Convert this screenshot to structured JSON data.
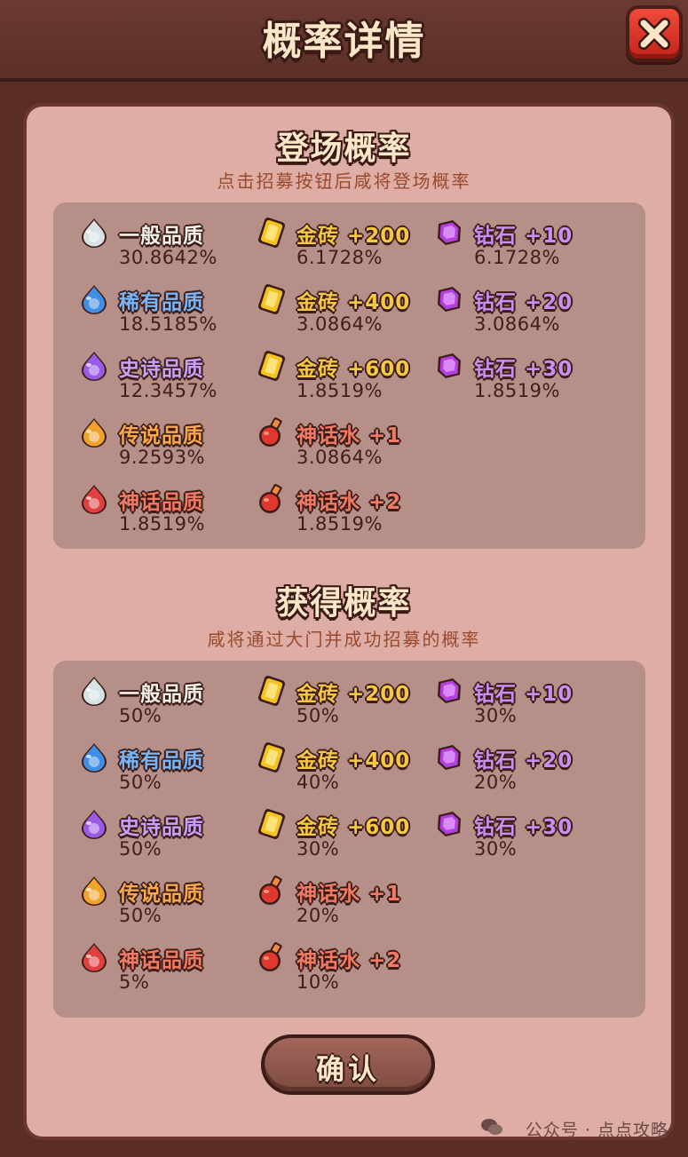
{
  "header": {
    "title": "概率详情"
  },
  "colors": {
    "common": "#f3f0ea",
    "rare": "#79b4f6",
    "epic": "#c9a0f7",
    "legend": "#f6a84b",
    "myth": "#f07a64",
    "gold": "#f6c842",
    "diamond": "#c98ef2",
    "potion": "#f07a64"
  },
  "sections": [
    {
      "title": "登场概率",
      "subtitle": "点击招募按钮后咸将登场概率",
      "columns": [
        [
          {
            "icon": "common-drop-icon",
            "name": "一般品质",
            "value": "30.8642%",
            "color_key": "common"
          },
          {
            "icon": "rare-drop-icon",
            "name": "稀有品质",
            "value": "18.5185%",
            "color_key": "rare"
          },
          {
            "icon": "epic-drop-icon",
            "name": "史诗品质",
            "value": "12.3457%",
            "color_key": "epic"
          },
          {
            "icon": "legend-drop-icon",
            "name": "传说品质",
            "value": "9.2593%",
            "color_key": "legend"
          },
          {
            "icon": "myth-drop-icon",
            "name": "神话品质",
            "value": "1.8519%",
            "color_key": "myth"
          }
        ],
        [
          {
            "icon": "gold-brick-icon",
            "name": "金砖 +200",
            "value": "6.1728%",
            "color_key": "gold"
          },
          {
            "icon": "gold-brick-icon",
            "name": "金砖 +400",
            "value": "3.0864%",
            "color_key": "gold"
          },
          {
            "icon": "gold-brick-icon",
            "name": "金砖 +600",
            "value": "1.8519%",
            "color_key": "gold"
          },
          {
            "icon": "myth-potion-icon",
            "name": "神话水 +1",
            "value": "3.0864%",
            "color_key": "potion"
          },
          {
            "icon": "myth-potion-icon",
            "name": "神话水 +2",
            "value": "1.8519%",
            "color_key": "potion"
          }
        ],
        [
          {
            "icon": "diamond-icon",
            "name": "钻石 +10",
            "value": "6.1728%",
            "color_key": "diamond"
          },
          {
            "icon": "diamond-icon",
            "name": "钻石 +20",
            "value": "3.0864%",
            "color_key": "diamond"
          },
          {
            "icon": "diamond-icon",
            "name": "钻石 +30",
            "value": "1.8519%",
            "color_key": "diamond"
          }
        ]
      ]
    },
    {
      "title": "获得概率",
      "subtitle": "咸将通过大门并成功招募的概率",
      "columns": [
        [
          {
            "icon": "common-drop-icon",
            "name": "一般品质",
            "value": "50%",
            "color_key": "common"
          },
          {
            "icon": "rare-drop-icon",
            "name": "稀有品质",
            "value": "50%",
            "color_key": "rare"
          },
          {
            "icon": "epic-drop-icon",
            "name": "史诗品质",
            "value": "50%",
            "color_key": "epic"
          },
          {
            "icon": "legend-drop-icon",
            "name": "传说品质",
            "value": "50%",
            "color_key": "legend"
          },
          {
            "icon": "myth-drop-icon",
            "name": "神话品质",
            "value": "5%",
            "color_key": "myth"
          }
        ],
        [
          {
            "icon": "gold-brick-icon",
            "name": "金砖 +200",
            "value": "50%",
            "color_key": "gold"
          },
          {
            "icon": "gold-brick-icon",
            "name": "金砖 +400",
            "value": "40%",
            "color_key": "gold"
          },
          {
            "icon": "gold-brick-icon",
            "name": "金砖 +600",
            "value": "30%",
            "color_key": "gold"
          },
          {
            "icon": "myth-potion-icon",
            "name": "神话水 +1",
            "value": "20%",
            "color_key": "potion"
          },
          {
            "icon": "myth-potion-icon",
            "name": "神话水 +2",
            "value": "10%",
            "color_key": "potion"
          }
        ],
        [
          {
            "icon": "diamond-icon",
            "name": "钻石 +10",
            "value": "30%",
            "color_key": "diamond"
          },
          {
            "icon": "diamond-icon",
            "name": "钻石 +20",
            "value": "20%",
            "color_key": "diamond"
          },
          {
            "icon": "diamond-icon",
            "name": "钻石 +30",
            "value": "30%",
            "color_key": "diamond"
          }
        ]
      ]
    }
  ],
  "footer": {
    "confirm_label": "确认",
    "watermark": "公众号 · 点点攻略"
  }
}
